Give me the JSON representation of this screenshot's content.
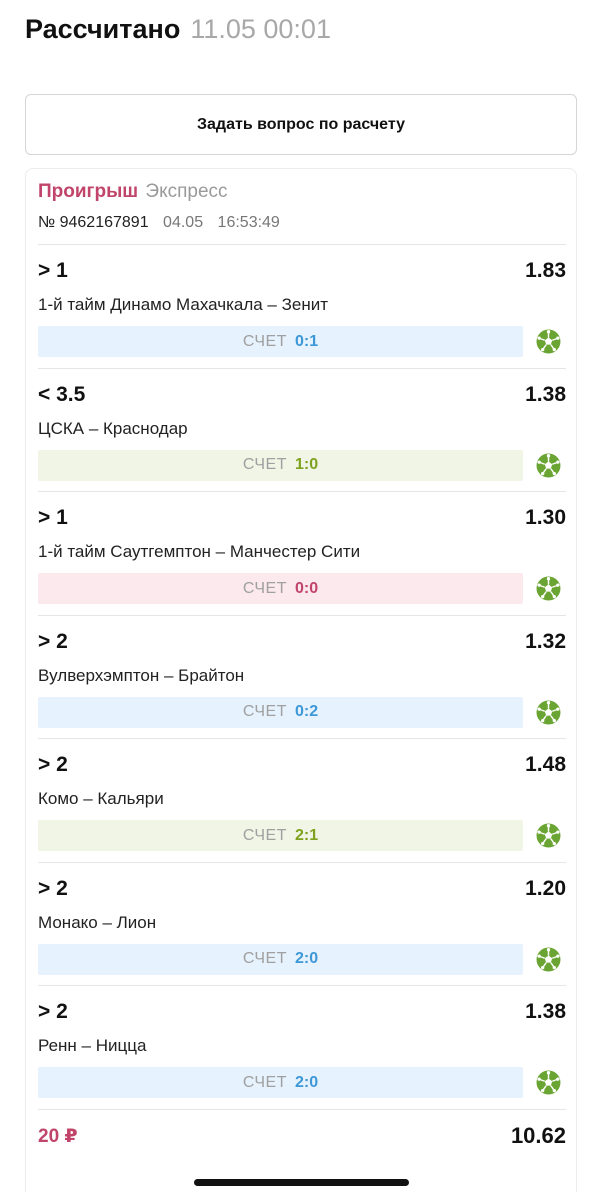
{
  "header": {
    "title": "Рассчитано",
    "date": "11.05 00:01"
  },
  "ask_button": {
    "label": "Задать вопрос по расчету"
  },
  "bet": {
    "status": "Проигрыш",
    "type": "Экспресс",
    "number": "№ 9462167891",
    "date": "04.05",
    "time": "16:53:49",
    "score_label": "СЧЕТ",
    "stake": "20 ₽",
    "total_coef": "10.62",
    "selections": [
      {
        "outcome": "> 1",
        "coef": "1.83",
        "event": "1-й тайм Динамо Махачкала – Зенит",
        "score": "0:1",
        "result": "blue"
      },
      {
        "outcome": "< 3.5",
        "coef": "1.38",
        "event": "ЦСКА – Краснодар",
        "score": "1:0",
        "result": "green"
      },
      {
        "outcome": "> 1",
        "coef": "1.30",
        "event": "1-й тайм Саутгемптон – Манчестер Сити",
        "score": "0:0",
        "result": "pink"
      },
      {
        "outcome": "> 2",
        "coef": "1.32",
        "event": "Вулверхэмптон – Брайтон",
        "score": "0:2",
        "result": "blue"
      },
      {
        "outcome": "> 2",
        "coef": "1.48",
        "event": "Комо – Кальяри",
        "score": "2:1",
        "result": "green"
      },
      {
        "outcome": "> 2",
        "coef": "1.20",
        "event": "Монако – Лион",
        "score": "2:0",
        "result": "blue"
      },
      {
        "outcome": "> 2",
        "coef": "1.38",
        "event": "Ренн – Ницца",
        "score": "2:0",
        "result": "blue"
      }
    ]
  },
  "icons": {
    "sport": "soccer-ball-icon"
  },
  "colors": {
    "lost": "#c1456a",
    "score_blue": "#3d98d8",
    "score_green": "#7fa21e",
    "sport_icon": "#6aa534"
  }
}
